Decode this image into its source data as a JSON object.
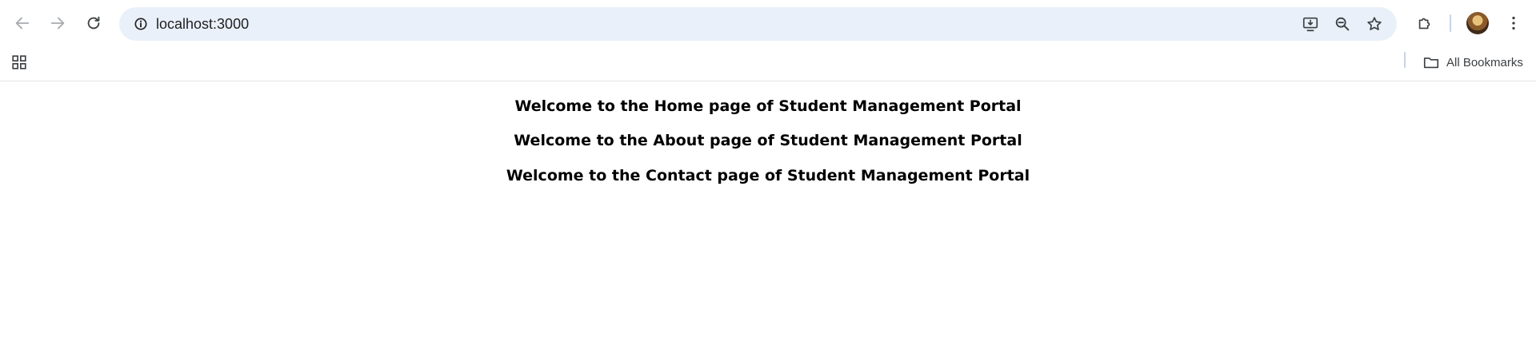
{
  "browser": {
    "url": "localhost:3000",
    "bookmarks_label": "All Bookmarks"
  },
  "icons": {
    "back": "arrow-left",
    "forward": "arrow-right",
    "reload": "reload",
    "site_info": "info",
    "install_app": "monitor-download",
    "zoom": "zoom-out",
    "bookmark_star": "star",
    "extensions": "puzzle",
    "profile": "avatar",
    "menu": "kebab",
    "apps": "grid",
    "folder": "folder"
  },
  "page": {
    "headings": [
      "Welcome to the Home page of Student Management Portal",
      "Welcome to the About page of Student Management Portal",
      "Welcome to the Contact page of Student Management Portal"
    ]
  },
  "colors": {
    "omnibox_bg": "#eaf0f9",
    "icon": "#3c4043",
    "icon_disabled": "#a8abaf",
    "text": "#000000"
  }
}
